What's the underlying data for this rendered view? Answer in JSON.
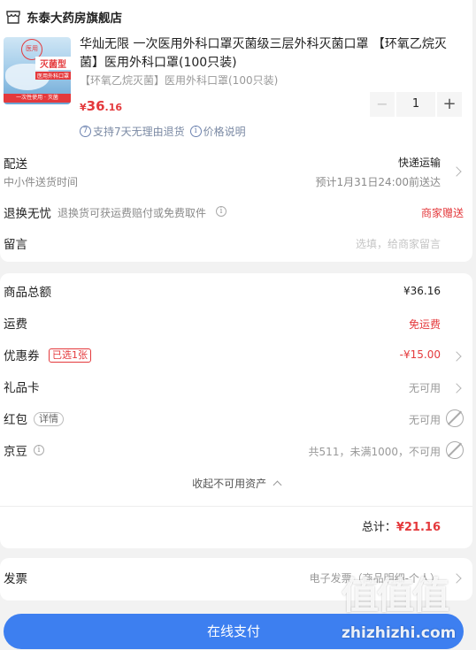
{
  "store": {
    "name": "东泰大药房旗舰店"
  },
  "product": {
    "title": "华灿无限 一次医用外科口罩灭菌级三层外科灭菌口罩 【环氧乙烷灭菌】医用外科口罩(100只装)",
    "spec": "【环氧乙烷灭菌】医用外科口罩(100只装)",
    "price_symbol": "¥",
    "price_int": "36",
    "price_dec": ".16",
    "quantity": "1",
    "minus": "−",
    "plus": "+",
    "return_policy": "支持7天无理由退货",
    "price_note": "价格说明",
    "image_text": {
      "line1": "灭菌型",
      "line2": "医用外科口罩",
      "badge": "医用",
      "bottom": "一次性使用 · 灭菌"
    }
  },
  "delivery": {
    "label": "配送",
    "sub": "中小件送货时间",
    "method": "快递运输",
    "eta": "预计1月31日24:00前送达"
  },
  "worry_free": {
    "label": "退换无忧",
    "desc": "退换货可获运费赔付或免费取件",
    "tag": "商家赠送"
  },
  "message": {
    "label": "留言",
    "placeholder": "选填，给商家留言"
  },
  "summary": {
    "goods_total_label": "商品总额",
    "goods_total": "¥36.16",
    "shipping_label": "运费",
    "shipping": "免运费",
    "coupon_label": "优惠券",
    "coupon_tag": "已选1张",
    "coupon_value": "-¥15.00",
    "gift_card_label": "礼品卡",
    "gift_card_value": "无可用",
    "red_packet_label": "红包",
    "red_packet_detail": "详情",
    "red_packet_value": "无可用",
    "jingdou_label": "京豆",
    "jingdou_value": "共511，未满1000，不可用",
    "collapse": "收起不可用资产",
    "total_label": "总计：",
    "total_value": "¥21.16"
  },
  "invoice": {
    "label": "发票",
    "value": "电子发票（商品明细-个人）"
  },
  "pay_button": "在线支付",
  "watermark": {
    "chars": "值值值",
    "site": "zhizhizhi.com"
  },
  "colors": {
    "accent": "#e4393c",
    "pay": "#3d7ff0"
  }
}
